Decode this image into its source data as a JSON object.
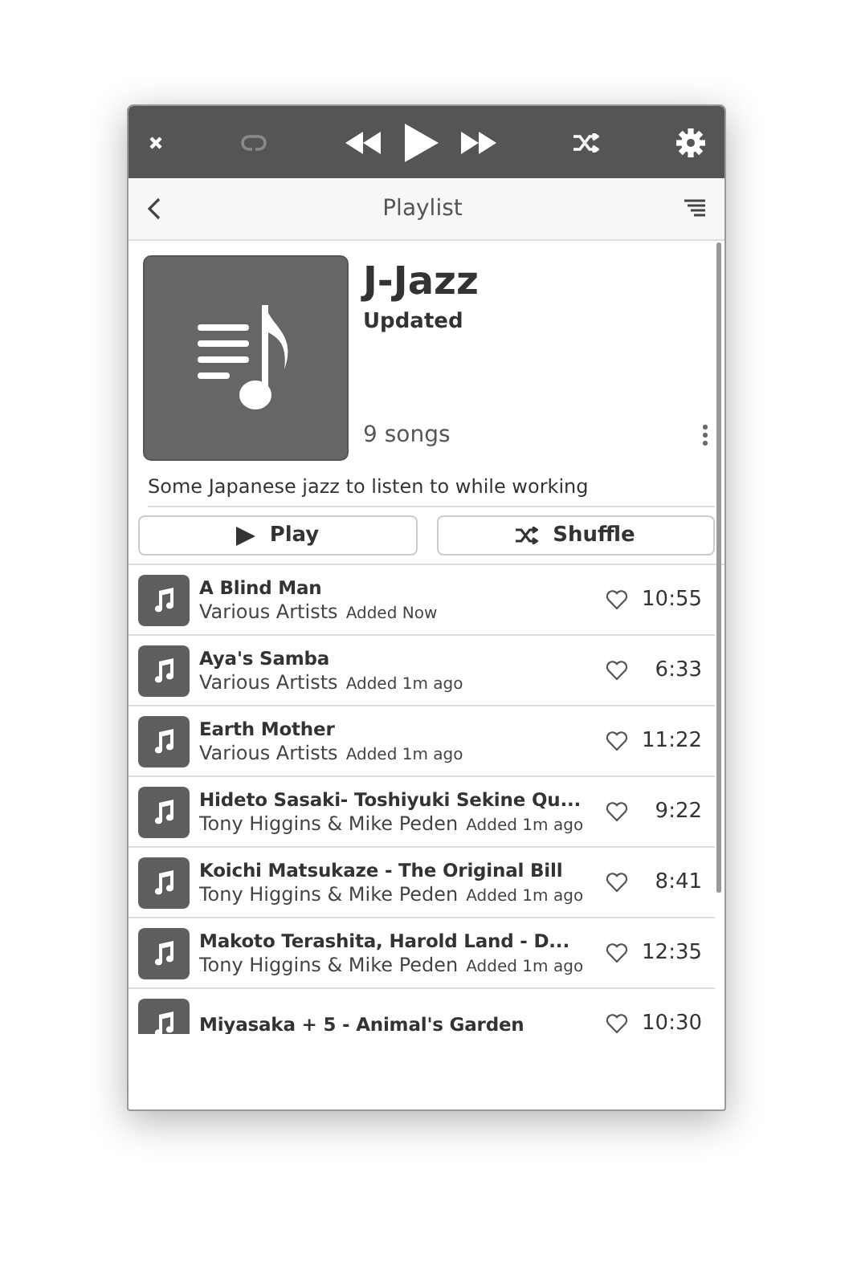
{
  "toolbar": {
    "repeat_on": false
  },
  "header": {
    "title": "Playlist"
  },
  "playlist": {
    "name": "J-Jazz",
    "status": "Updated",
    "count": "9 songs",
    "description": "Some Japanese jazz to listen to while working"
  },
  "buttons": [
    {
      "kind": "play",
      "label": "Play"
    },
    {
      "kind": "shuffle",
      "label": "Shuffle"
    }
  ],
  "songs": [
    {
      "title": "A Blind Man",
      "artist": "Various Artists",
      "added": "Added Now",
      "duration": "10:55"
    },
    {
      "title": "Aya's Samba",
      "artist": "Various Artists",
      "added": "Added 1m ago",
      "duration": "6:33"
    },
    {
      "title": "Earth Mother",
      "artist": "Various Artists",
      "added": "Added 1m ago",
      "duration": "11:22"
    },
    {
      "title": "Hideto Sasaki- Toshiyuki Sekine Qu...",
      "artist": "Tony Higgins & Mike Peden",
      "added": "Added 1m ago",
      "duration": "9:22"
    },
    {
      "title": "Koichi Matsukaze - The Original Bill",
      "artist": "Tony Higgins & Mike Peden",
      "added": "Added 1m ago",
      "duration": "8:41"
    },
    {
      "title": "Makoto Terashita, Harold Land - D...",
      "artist": "Tony Higgins & Mike Peden",
      "added": "Added 1m ago",
      "duration": "12:35"
    },
    {
      "title": "Miyasaka + 5 - Animal's Garden",
      "duration": "10:30"
    }
  ]
}
